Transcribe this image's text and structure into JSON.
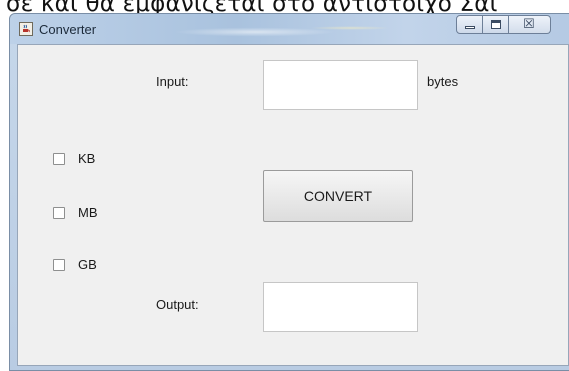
{
  "caption": {
    "text": "σε και θα εμφανίζεται στο αντίστοιχο Σαι"
  },
  "window": {
    "title": "Converter",
    "title_icon": "java-cup-icon",
    "controls": {
      "minimize_icon": "minimize-icon",
      "maximize_icon": "maximize-icon",
      "close_icon": "close-icon",
      "close_glyph": "☒"
    }
  },
  "form": {
    "input_label": "Input:",
    "input_value": "",
    "input_unit": "bytes",
    "checkboxes": [
      {
        "label": "KB",
        "checked": false
      },
      {
        "label": "MB",
        "checked": false
      },
      {
        "label": "GB",
        "checked": false
      }
    ],
    "convert_label": "CONVERT",
    "output_label": "Output:",
    "output_value": ""
  }
}
